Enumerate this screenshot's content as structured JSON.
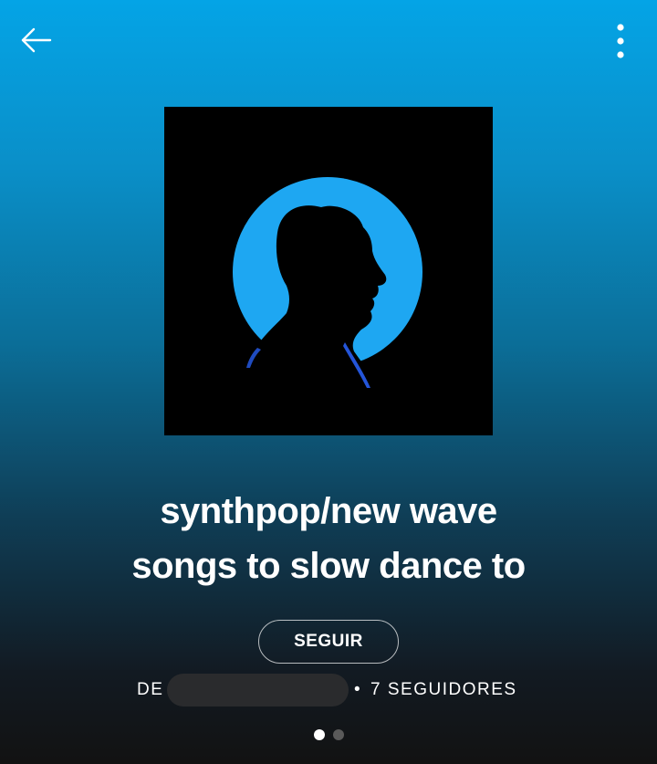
{
  "header": {
    "back_icon": "arrow-left-icon",
    "more_icon": "more-vertical-icon"
  },
  "playlist": {
    "cover_icon": "silhouette-cover-art",
    "title": "synthpop/new wave\nsongs to slow dance to",
    "follow_label": "SEGUIR",
    "by_label": "DE",
    "separator": "•",
    "followers_label": "7 SEGUIDORES"
  },
  "pager": {
    "pages": 2,
    "active": 1
  },
  "colors": {
    "gradient_top": "#04a4e6",
    "background_bottom": "#121212",
    "cover_circle": "#1ea7f2",
    "redaction": "#2a2b2d"
  }
}
